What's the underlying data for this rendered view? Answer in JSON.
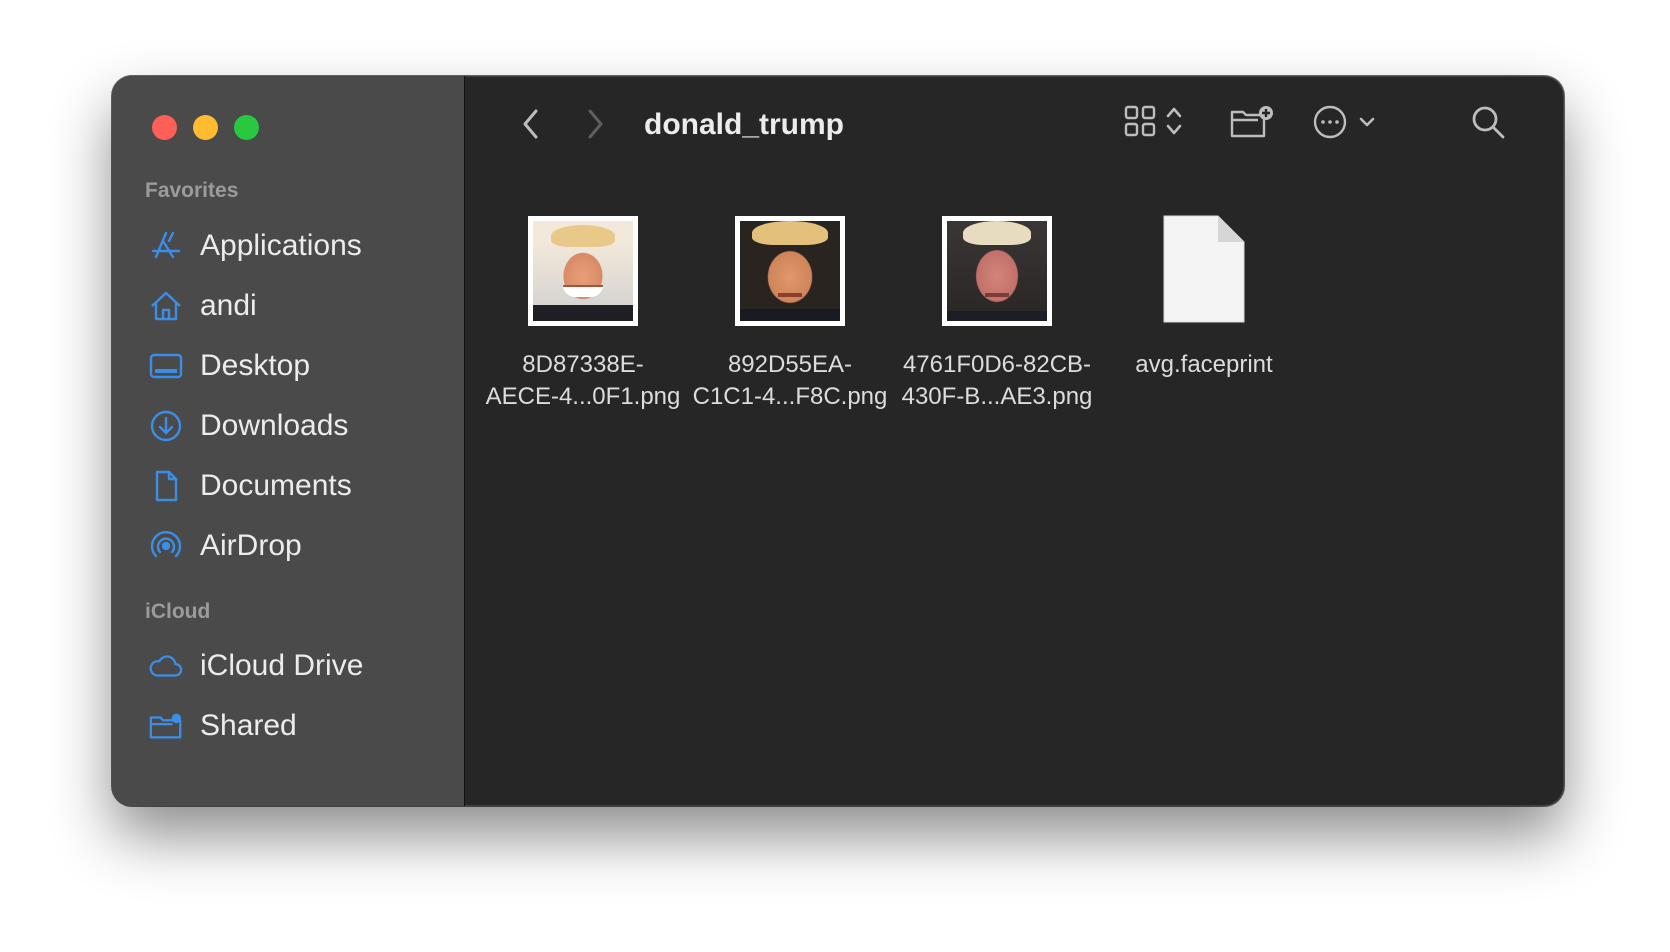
{
  "window": {
    "title": "donald_trump"
  },
  "sidebar": {
    "sections": [
      {
        "label": "Favorites",
        "items": [
          {
            "label": "Applications",
            "icon": "applications-icon"
          },
          {
            "label": "andi",
            "icon": "home-icon"
          },
          {
            "label": "Desktop",
            "icon": "desktop-icon"
          },
          {
            "label": "Downloads",
            "icon": "downloads-icon"
          },
          {
            "label": "Documents",
            "icon": "document-icon"
          },
          {
            "label": "AirDrop",
            "icon": "airdrop-icon"
          }
        ]
      },
      {
        "label": "iCloud",
        "items": [
          {
            "label": "iCloud Drive",
            "icon": "cloud-icon"
          },
          {
            "label": "Shared",
            "icon": "shared-folder-icon"
          }
        ]
      }
    ]
  },
  "toolbar": {
    "back_icon": "chevron-left-icon",
    "forward_icon": "chevron-right-icon",
    "view_icon": "grid-view-icon",
    "new_folder_icon": "new-folder-icon",
    "more_icon": "ellipsis-circle-icon",
    "search_icon": "search-icon"
  },
  "files": [
    {
      "name_line1": "8D87338E-",
      "name_line2": "AECE-4...0F1.png",
      "kind": "image"
    },
    {
      "name_line1": "892D55EA-",
      "name_line2": "C1C1-4...F8C.png",
      "kind": "image"
    },
    {
      "name_line1": "4761F0D6-82CB-",
      "name_line2": "430F-B...AE3.png",
      "kind": "image"
    },
    {
      "name_line1": "avg.faceprint",
      "name_line2": "",
      "kind": "document"
    }
  ],
  "colors": {
    "accent": "#3a8ee6",
    "sidebar_bg": "#4a4a4b",
    "content_bg": "#262626"
  }
}
